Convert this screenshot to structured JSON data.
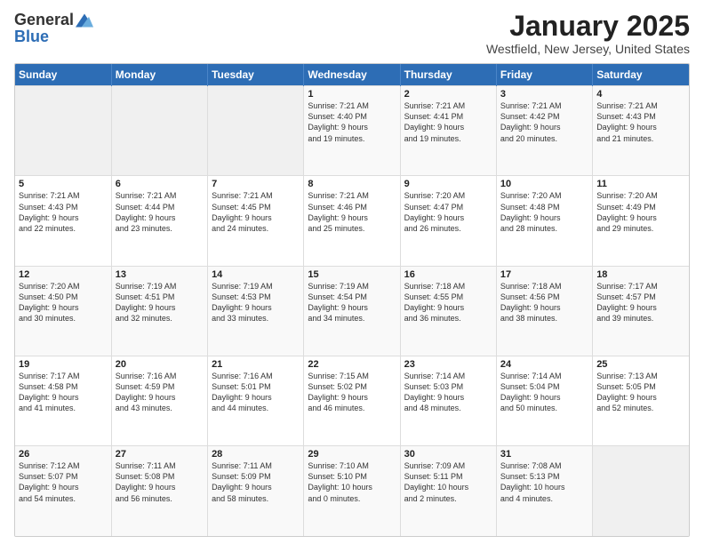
{
  "logo": {
    "general": "General",
    "blue": "Blue"
  },
  "title": "January 2025",
  "location": "Westfield, New Jersey, United States",
  "days_header": [
    "Sunday",
    "Monday",
    "Tuesday",
    "Wednesday",
    "Thursday",
    "Friday",
    "Saturday"
  ],
  "weeks": [
    [
      {
        "day": "",
        "info": ""
      },
      {
        "day": "",
        "info": ""
      },
      {
        "day": "",
        "info": ""
      },
      {
        "day": "1",
        "info": "Sunrise: 7:21 AM\nSunset: 4:40 PM\nDaylight: 9 hours\nand 19 minutes."
      },
      {
        "day": "2",
        "info": "Sunrise: 7:21 AM\nSunset: 4:41 PM\nDaylight: 9 hours\nand 19 minutes."
      },
      {
        "day": "3",
        "info": "Sunrise: 7:21 AM\nSunset: 4:42 PM\nDaylight: 9 hours\nand 20 minutes."
      },
      {
        "day": "4",
        "info": "Sunrise: 7:21 AM\nSunset: 4:43 PM\nDaylight: 9 hours\nand 21 minutes."
      }
    ],
    [
      {
        "day": "5",
        "info": "Sunrise: 7:21 AM\nSunset: 4:43 PM\nDaylight: 9 hours\nand 22 minutes."
      },
      {
        "day": "6",
        "info": "Sunrise: 7:21 AM\nSunset: 4:44 PM\nDaylight: 9 hours\nand 23 minutes."
      },
      {
        "day": "7",
        "info": "Sunrise: 7:21 AM\nSunset: 4:45 PM\nDaylight: 9 hours\nand 24 minutes."
      },
      {
        "day": "8",
        "info": "Sunrise: 7:21 AM\nSunset: 4:46 PM\nDaylight: 9 hours\nand 25 minutes."
      },
      {
        "day": "9",
        "info": "Sunrise: 7:20 AM\nSunset: 4:47 PM\nDaylight: 9 hours\nand 26 minutes."
      },
      {
        "day": "10",
        "info": "Sunrise: 7:20 AM\nSunset: 4:48 PM\nDaylight: 9 hours\nand 28 minutes."
      },
      {
        "day": "11",
        "info": "Sunrise: 7:20 AM\nSunset: 4:49 PM\nDaylight: 9 hours\nand 29 minutes."
      }
    ],
    [
      {
        "day": "12",
        "info": "Sunrise: 7:20 AM\nSunset: 4:50 PM\nDaylight: 9 hours\nand 30 minutes."
      },
      {
        "day": "13",
        "info": "Sunrise: 7:19 AM\nSunset: 4:51 PM\nDaylight: 9 hours\nand 32 minutes."
      },
      {
        "day": "14",
        "info": "Sunrise: 7:19 AM\nSunset: 4:53 PM\nDaylight: 9 hours\nand 33 minutes."
      },
      {
        "day": "15",
        "info": "Sunrise: 7:19 AM\nSunset: 4:54 PM\nDaylight: 9 hours\nand 34 minutes."
      },
      {
        "day": "16",
        "info": "Sunrise: 7:18 AM\nSunset: 4:55 PM\nDaylight: 9 hours\nand 36 minutes."
      },
      {
        "day": "17",
        "info": "Sunrise: 7:18 AM\nSunset: 4:56 PM\nDaylight: 9 hours\nand 38 minutes."
      },
      {
        "day": "18",
        "info": "Sunrise: 7:17 AM\nSunset: 4:57 PM\nDaylight: 9 hours\nand 39 minutes."
      }
    ],
    [
      {
        "day": "19",
        "info": "Sunrise: 7:17 AM\nSunset: 4:58 PM\nDaylight: 9 hours\nand 41 minutes."
      },
      {
        "day": "20",
        "info": "Sunrise: 7:16 AM\nSunset: 4:59 PM\nDaylight: 9 hours\nand 43 minutes."
      },
      {
        "day": "21",
        "info": "Sunrise: 7:16 AM\nSunset: 5:01 PM\nDaylight: 9 hours\nand 44 minutes."
      },
      {
        "day": "22",
        "info": "Sunrise: 7:15 AM\nSunset: 5:02 PM\nDaylight: 9 hours\nand 46 minutes."
      },
      {
        "day": "23",
        "info": "Sunrise: 7:14 AM\nSunset: 5:03 PM\nDaylight: 9 hours\nand 48 minutes."
      },
      {
        "day": "24",
        "info": "Sunrise: 7:14 AM\nSunset: 5:04 PM\nDaylight: 9 hours\nand 50 minutes."
      },
      {
        "day": "25",
        "info": "Sunrise: 7:13 AM\nSunset: 5:05 PM\nDaylight: 9 hours\nand 52 minutes."
      }
    ],
    [
      {
        "day": "26",
        "info": "Sunrise: 7:12 AM\nSunset: 5:07 PM\nDaylight: 9 hours\nand 54 minutes."
      },
      {
        "day": "27",
        "info": "Sunrise: 7:11 AM\nSunset: 5:08 PM\nDaylight: 9 hours\nand 56 minutes."
      },
      {
        "day": "28",
        "info": "Sunrise: 7:11 AM\nSunset: 5:09 PM\nDaylight: 9 hours\nand 58 minutes."
      },
      {
        "day": "29",
        "info": "Sunrise: 7:10 AM\nSunset: 5:10 PM\nDaylight: 10 hours\nand 0 minutes."
      },
      {
        "day": "30",
        "info": "Sunrise: 7:09 AM\nSunset: 5:11 PM\nDaylight: 10 hours\nand 2 minutes."
      },
      {
        "day": "31",
        "info": "Sunrise: 7:08 AM\nSunset: 5:13 PM\nDaylight: 10 hours\nand 4 minutes."
      },
      {
        "day": "",
        "info": ""
      }
    ]
  ]
}
